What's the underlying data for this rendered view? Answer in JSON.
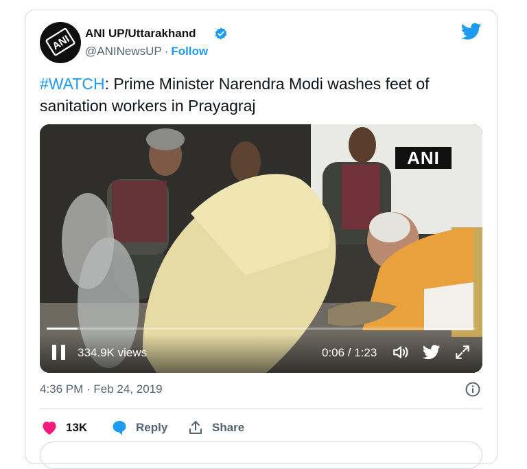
{
  "author": {
    "name": "ANI UP/Uttarakhand",
    "handle": "@ANINewsUP",
    "separator": "·",
    "follow_label": "Follow",
    "logo_text": "ANI"
  },
  "tweet": {
    "hashtag": "#WATCH",
    "text": ": Prime Minister Narendra Modi washes feet of sanitation workers in Prayagraj"
  },
  "video": {
    "watermark": "ANI",
    "views": "334.9K views",
    "time": "0:06 / 1:23",
    "progress": 0.072
  },
  "timestamp": "4:36 PM · Feb 24, 2019",
  "actions": {
    "likes": "13K",
    "reply_label": "Reply",
    "share_label": "Share"
  },
  "colors": {
    "accent": "#1d9bf0",
    "like": "#f91880",
    "muted": "#536471"
  }
}
